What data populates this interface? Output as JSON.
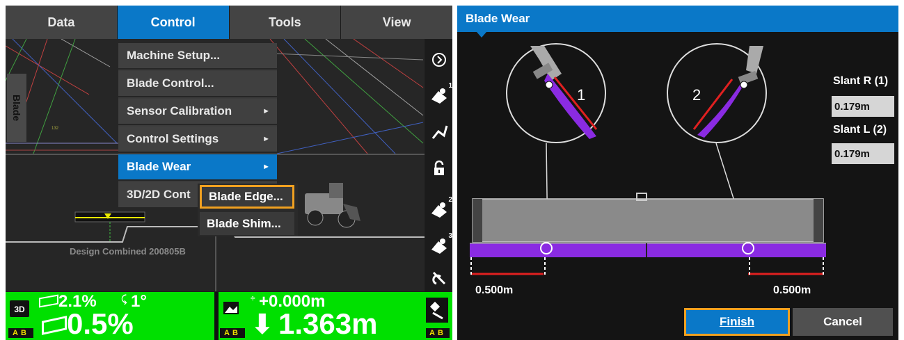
{
  "menu_bar": {
    "tabs": [
      {
        "label": "Data"
      },
      {
        "label": "Control"
      },
      {
        "label": "Tools"
      },
      {
        "label": "View"
      }
    ]
  },
  "plan_view": {
    "side_label": "Blade",
    "small_mark": "132"
  },
  "control_menu": {
    "items": [
      {
        "label": "Machine Setup..."
      },
      {
        "label": "Blade Control..."
      },
      {
        "label": "Sensor Calibration"
      },
      {
        "label": "Control Settings"
      },
      {
        "label": "Blade Wear"
      },
      {
        "label": "3D/2D Cont"
      }
    ]
  },
  "blade_wear_submenu": {
    "items": [
      {
        "label": "Blade Edge..."
      },
      {
        "label": "Blade Shim..."
      }
    ]
  },
  "profile_view": {
    "design_label": "Design Combined 200805B"
  },
  "side_toolbar": {
    "badges": [
      "1",
      "2",
      "3"
    ]
  },
  "status_bar": {
    "mode_3d": "3D",
    "mode_ab": "AB",
    "cross_slope": "2.1%",
    "rotation": "1°",
    "main_slope": "0.5%",
    "elev_small": "+0.000m",
    "elev_big": "1.363m",
    "lr_badge": "AB",
    "gps_badge": "AB"
  },
  "blade_wear_dialog": {
    "title": "Blade Wear",
    "slant_r_label": "Slant R (1)",
    "slant_r_value": "0.179m",
    "slant_l_label": "Slant L (2)",
    "slant_l_value": "0.179m",
    "circle_right_num": "1",
    "circle_left_num": "2",
    "edge_left_value": "0.500m",
    "edge_right_value": "0.500m",
    "finish_label": "Finish",
    "cancel_label": "Cancel"
  },
  "colors": {
    "accent": "#0a78c8",
    "highlight": "#f0a020",
    "status_green": "#00e000",
    "wear_purple": "#8a2be2",
    "edge_red": "#e02020"
  }
}
